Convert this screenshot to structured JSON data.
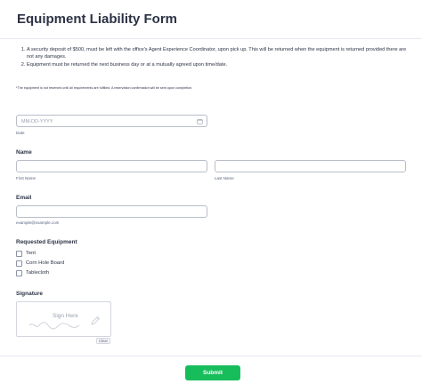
{
  "form": {
    "title": "Equipment Liability Form",
    "terms": [
      "A security deposit of $500, must be left with the office's Agent Experience Coordinator, upon pick up. This will be returned when the equipment is returned provided there are not any damages.",
      "Equipment must be returned the next business day or at a mutually agreed upon time/date."
    ],
    "fine_print": "*The equipment is not reserved until all requirements are fulfilled. A reservation confirmation will be sent upon completion."
  },
  "date_field": {
    "placeholder": "MM-DD-YYYY",
    "sublabel": "Date",
    "icon": "calendar-icon"
  },
  "name_field": {
    "label": "Name",
    "first_sublabel": "First Name",
    "last_sublabel": "Last Name",
    "first_value": "",
    "last_value": ""
  },
  "email_field": {
    "label": "Email",
    "sublabel": "example@example.com",
    "value": ""
  },
  "equipment": {
    "label": "Requested Equipment",
    "options": [
      "Tent",
      "Corn Hole Board",
      "Tablecloth"
    ]
  },
  "signature": {
    "label": "Signature",
    "placeholder": "Sign Here",
    "clear_label": "Clear",
    "icon": "pen-icon"
  },
  "submit": {
    "label": "Submit",
    "color": "#18bd5b"
  }
}
